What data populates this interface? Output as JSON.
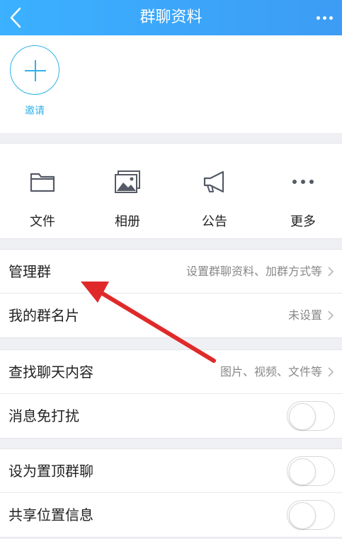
{
  "header": {
    "title": "群聊资料"
  },
  "invite": {
    "label": "邀请"
  },
  "grid": [
    {
      "label": "文件",
      "icon": "folder-icon"
    },
    {
      "label": "相册",
      "icon": "album-icon"
    },
    {
      "label": "公告",
      "icon": "megaphone-icon"
    },
    {
      "label": "更多",
      "icon": "more-dots-icon"
    }
  ],
  "manage": {
    "label": "管理群",
    "value": "设置群聊资料、加群方式等"
  },
  "nickname": {
    "label": "我的群名片",
    "value": "未设置"
  },
  "search": {
    "label": "查找聊天内容",
    "value": "图片、视频、文件等"
  },
  "mute": {
    "label": "消息免打扰",
    "on": false
  },
  "pin": {
    "label": "设为置顶群聊",
    "on": false
  },
  "location": {
    "label": "共享位置信息",
    "on": false
  },
  "colors": {
    "header": "#3da6fa",
    "accent": "#2fb3e8",
    "annotation_arrow": "#e02a2a"
  }
}
